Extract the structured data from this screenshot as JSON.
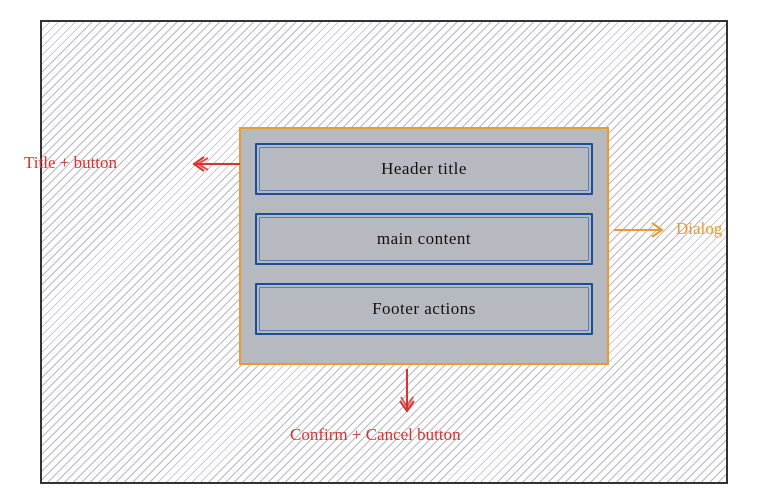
{
  "dialog": {
    "header_label": "Header title",
    "main_label": "main content",
    "footer_label": "Footer actions"
  },
  "annotations": {
    "title_button": "Title + button",
    "dialog": "Dialog",
    "confirm_cancel": "Confirm + Cancel button"
  }
}
